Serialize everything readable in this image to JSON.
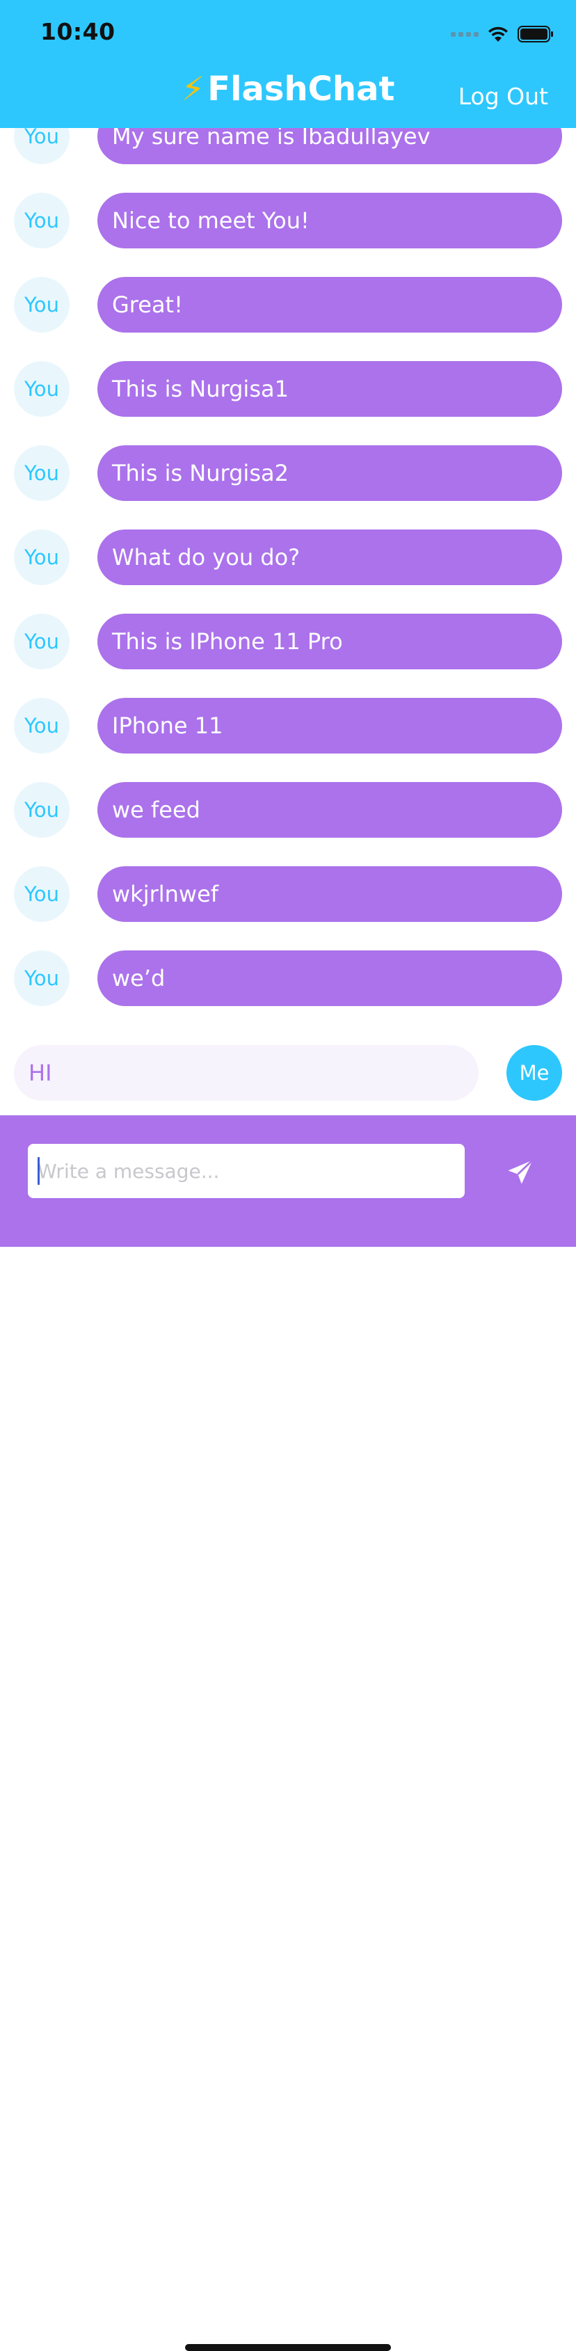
{
  "status_bar": {
    "time": "10:40"
  },
  "nav": {
    "bolt": "⚡",
    "title": "FlashChat",
    "logout_label": "Log Out"
  },
  "messages": [
    {
      "sender": "You",
      "text": "My sure name is Ibadullayev"
    },
    {
      "sender": "You",
      "text": "Nice to meet You!"
    },
    {
      "sender": "You",
      "text": "Great!"
    },
    {
      "sender": "You",
      "text": "This is Nurgisa1"
    },
    {
      "sender": "You",
      "text": "This is Nurgisa2"
    },
    {
      "sender": "You",
      "text": "What do you do?"
    },
    {
      "sender": "You",
      "text": "This is IPhone 11 Pro"
    },
    {
      "sender": "You",
      "text": "IPhone 11"
    },
    {
      "sender": "You",
      "text": "we feed"
    },
    {
      "sender": "You",
      "text": "wkjrlnwef"
    },
    {
      "sender": "You",
      "text": "we’d"
    },
    {
      "sender": "Me",
      "text": "HI"
    }
  ],
  "compose": {
    "placeholder": "Write a message...",
    "value": ""
  },
  "colors": {
    "header": "#2dc7fe",
    "bubble_you": "#ab72eb",
    "bubble_me": "#f7f3fd",
    "avatar_me": "#2dc7fe",
    "compose_bar": "#ab72eb"
  },
  "icons": {
    "send": "paper-plane-icon",
    "wifi": "wifi-icon",
    "battery": "battery-icon",
    "cellular": "cellular-signal-icon"
  }
}
